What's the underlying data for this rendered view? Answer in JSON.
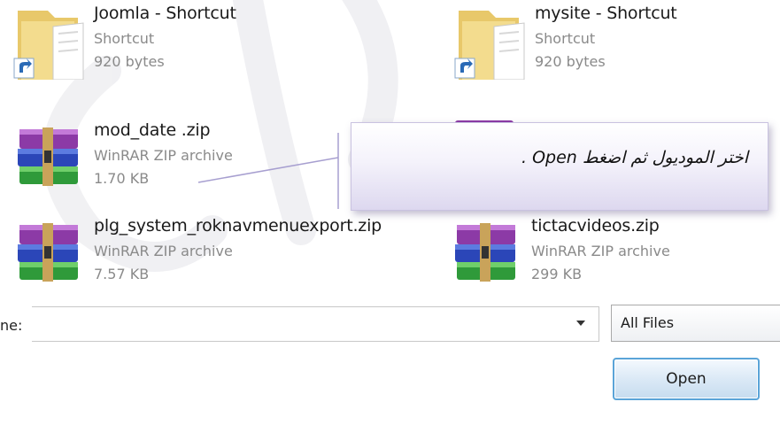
{
  "files": [
    {
      "name": "Joomla - Shortcut",
      "type": "Shortcut",
      "size": "920 bytes",
      "icon": "folder-shortcut-icon"
    },
    {
      "name": "mysite - Shortcut",
      "type": "Shortcut",
      "size": "920 bytes",
      "icon": "folder-shortcut-icon"
    },
    {
      "name": "mod_date .zip",
      "type": "WinRAR ZIP archive",
      "size": "1.70 KB",
      "icon": "winrar-archive-icon"
    },
    {
      "name": "plg_system_roknavmenuexport.zip",
      "type": "WinRAR ZIP archive",
      "size": "7.57 KB",
      "icon": "winrar-archive-icon"
    },
    {
      "name": "tictacvideos.zip",
      "type": "WinRAR ZIP archive",
      "size": "299 KB",
      "icon": "winrar-archive-icon"
    }
  ],
  "callout": {
    "text": "اختر الموديول ثم اضغط Open ."
  },
  "footer": {
    "filename_label": "ne:",
    "filter_value": "All Files",
    "open_label": "Open"
  },
  "colors": {
    "accent": "#5aa4d8",
    "callout_border": "#c9c2e0",
    "secondary_text": "#8a8a8a"
  }
}
